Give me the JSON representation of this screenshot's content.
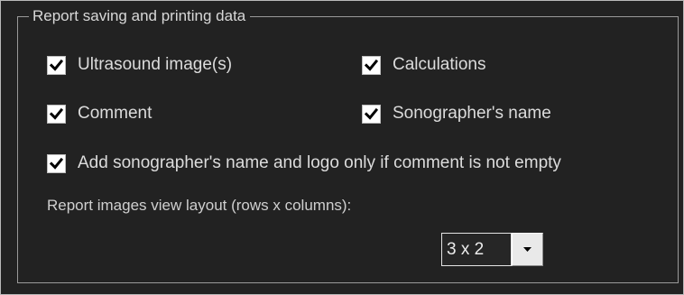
{
  "group": {
    "title": "Report saving and printing data"
  },
  "options": {
    "ultrasound_images": {
      "label": "Ultrasound image(s)",
      "checked": true
    },
    "calculations": {
      "label": "Calculations",
      "checked": true
    },
    "comment": {
      "label": "Comment",
      "checked": true
    },
    "sonographer_name": {
      "label": "Sonographer's name",
      "checked": true
    },
    "add_name_logo": {
      "label": "Add sonographer's name and logo only if comment is not empty",
      "checked": true
    }
  },
  "layout": {
    "label": "Report images view layout (rows x columns):",
    "selected": "3 x 2"
  },
  "icons": {
    "checkmark": "checkmark-icon",
    "dropdown": "chevron-down-icon"
  },
  "colors": {
    "background": "#222222",
    "text": "#dcdcdc",
    "checkbox_fill": "#ffffff",
    "checkmark": "#000000"
  }
}
